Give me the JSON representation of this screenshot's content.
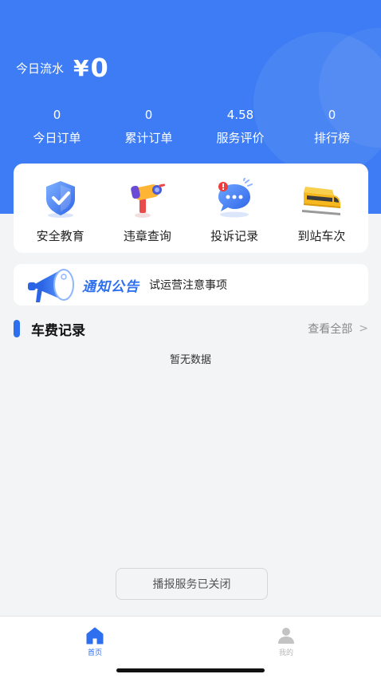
{
  "header": {
    "title": "",
    "earnings_label": "今日流水",
    "currency_symbol": "¥",
    "earnings_amount": "0",
    "stats": [
      {
        "value": "0",
        "label": "今日订单"
      },
      {
        "value": "0",
        "label": "累计订单"
      },
      {
        "value": "4.58",
        "label": "服务评价"
      },
      {
        "value": "0",
        "label": "排行榜"
      }
    ]
  },
  "quick_actions": [
    {
      "label": "安全教育",
      "icon": "shield-check-icon"
    },
    {
      "label": "违章查询",
      "icon": "camera-icon"
    },
    {
      "label": "投诉记录",
      "icon": "chat-bubble-icon"
    },
    {
      "label": "到站车次",
      "icon": "train-icon"
    }
  ],
  "notice": {
    "title": "通知公告",
    "text": "试运营注意事项",
    "icon": "megaphone-icon"
  },
  "fare_section": {
    "title": "车费记录",
    "view_all": "查看全部",
    "empty_text": "暂无数据"
  },
  "broadcast_button": "播报服务已关闭",
  "tabbar": {
    "home_label": "首页",
    "mine_label": "我的"
  },
  "colors": {
    "primary": "#3d7cf4",
    "accent": "#2d6fee",
    "background": "#f3f4f6"
  }
}
